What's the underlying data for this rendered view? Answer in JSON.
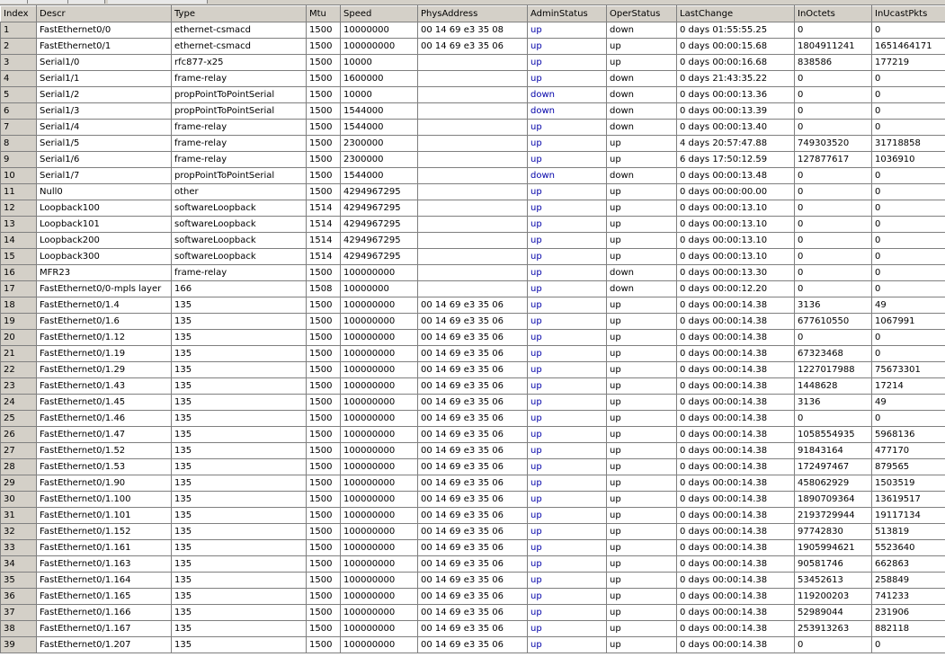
{
  "table": {
    "columns": [
      "Index",
      "Descr",
      "Type",
      "Mtu",
      "Speed",
      "PhysAddress",
      "AdminStatus",
      "OperStatus",
      "LastChange",
      "InOctets",
      "InUcastPkts"
    ],
    "rows": [
      [
        "1",
        "FastEthernet0/0",
        "ethernet-csmacd",
        "1500",
        "10000000",
        "00 14 69 e3 35 08",
        "up",
        "down",
        "0 days 01:55:55.25",
        "0",
        "0"
      ],
      [
        "2",
        "FastEthernet0/1",
        "ethernet-csmacd",
        "1500",
        "100000000",
        "00 14 69 e3 35 06",
        "up",
        "up",
        "0 days 00:00:15.68",
        "1804911241",
        "1651464171"
      ],
      [
        "3",
        "Serial1/0",
        "rfc877-x25",
        "1500",
        "10000",
        "",
        "up",
        "up",
        "0 days 00:00:16.68",
        "838586",
        "177219"
      ],
      [
        "4",
        "Serial1/1",
        "frame-relay",
        "1500",
        "1600000",
        "",
        "up",
        "down",
        "0 days 21:43:35.22",
        "0",
        "0"
      ],
      [
        "5",
        "Serial1/2",
        "propPointToPointSerial",
        "1500",
        "10000",
        "",
        "down",
        "down",
        "0 days 00:00:13.36",
        "0",
        "0"
      ],
      [
        "6",
        "Serial1/3",
        "propPointToPointSerial",
        "1500",
        "1544000",
        "",
        "down",
        "down",
        "0 days 00:00:13.39",
        "0",
        "0"
      ],
      [
        "7",
        "Serial1/4",
        "frame-relay",
        "1500",
        "1544000",
        "",
        "up",
        "down",
        "0 days 00:00:13.40",
        "0",
        "0"
      ],
      [
        "8",
        "Serial1/5",
        "frame-relay",
        "1500",
        "2300000",
        "",
        "up",
        "up",
        "4 days 20:57:47.88",
        "749303520",
        "31718858"
      ],
      [
        "9",
        "Serial1/6",
        "frame-relay",
        "1500",
        "2300000",
        "",
        "up",
        "up",
        "6 days 17:50:12.59",
        "127877617",
        "1036910"
      ],
      [
        "10",
        "Serial1/7",
        "propPointToPointSerial",
        "1500",
        "1544000",
        "",
        "down",
        "down",
        "0 days 00:00:13.48",
        "0",
        "0"
      ],
      [
        "11",
        "Null0",
        "other",
        "1500",
        "4294967295",
        "",
        "up",
        "up",
        "0 days 00:00:00.00",
        "0",
        "0"
      ],
      [
        "12",
        "Loopback100",
        "softwareLoopback",
        "1514",
        "4294967295",
        "",
        "up",
        "up",
        "0 days 00:00:13.10",
        "0",
        "0"
      ],
      [
        "13",
        "Loopback101",
        "softwareLoopback",
        "1514",
        "4294967295",
        "",
        "up",
        "up",
        "0 days 00:00:13.10",
        "0",
        "0"
      ],
      [
        "14",
        "Loopback200",
        "softwareLoopback",
        "1514",
        "4294967295",
        "",
        "up",
        "up",
        "0 days 00:00:13.10",
        "0",
        "0"
      ],
      [
        "15",
        "Loopback300",
        "softwareLoopback",
        "1514",
        "4294967295",
        "",
        "up",
        "up",
        "0 days 00:00:13.10",
        "0",
        "0"
      ],
      [
        "16",
        "MFR23",
        "frame-relay",
        "1500",
        "100000000",
        "",
        "up",
        "down",
        "0 days 00:00:13.30",
        "0",
        "0"
      ],
      [
        "17",
        "FastEthernet0/0-mpls layer",
        "166",
        "1508",
        "10000000",
        "",
        "up",
        "down",
        "0 days 00:00:12.20",
        "0",
        "0"
      ],
      [
        "18",
        "FastEthernet0/1.4",
        "135",
        "1500",
        "100000000",
        "00 14 69 e3 35 06",
        "up",
        "up",
        "0 days 00:00:14.38",
        "3136",
        "49"
      ],
      [
        "19",
        "FastEthernet0/1.6",
        "135",
        "1500",
        "100000000",
        "00 14 69 e3 35 06",
        "up",
        "up",
        "0 days 00:00:14.38",
        "677610550",
        "1067991"
      ],
      [
        "20",
        "FastEthernet0/1.12",
        "135",
        "1500",
        "100000000",
        "00 14 69 e3 35 06",
        "up",
        "up",
        "0 days 00:00:14.38",
        "0",
        "0"
      ],
      [
        "21",
        "FastEthernet0/1.19",
        "135",
        "1500",
        "100000000",
        "00 14 69 e3 35 06",
        "up",
        "up",
        "0 days 00:00:14.38",
        "67323468",
        "0"
      ],
      [
        "22",
        "FastEthernet0/1.29",
        "135",
        "1500",
        "100000000",
        "00 14 69 e3 35 06",
        "up",
        "up",
        "0 days 00:00:14.38",
        "1227017988",
        "75673301"
      ],
      [
        "23",
        "FastEthernet0/1.43",
        "135",
        "1500",
        "100000000",
        "00 14 69 e3 35 06",
        "up",
        "up",
        "0 days 00:00:14.38",
        "1448628",
        "17214"
      ],
      [
        "24",
        "FastEthernet0/1.45",
        "135",
        "1500",
        "100000000",
        "00 14 69 e3 35 06",
        "up",
        "up",
        "0 days 00:00:14.38",
        "3136",
        "49"
      ],
      [
        "25",
        "FastEthernet0/1.46",
        "135",
        "1500",
        "100000000",
        "00 14 69 e3 35 06",
        "up",
        "up",
        "0 days 00:00:14.38",
        "0",
        "0"
      ],
      [
        "26",
        "FastEthernet0/1.47",
        "135",
        "1500",
        "100000000",
        "00 14 69 e3 35 06",
        "up",
        "up",
        "0 days 00:00:14.38",
        "1058554935",
        "5968136"
      ],
      [
        "27",
        "FastEthernet0/1.52",
        "135",
        "1500",
        "100000000",
        "00 14 69 e3 35 06",
        "up",
        "up",
        "0 days 00:00:14.38",
        "91843164",
        "477170"
      ],
      [
        "28",
        "FastEthernet0/1.53",
        "135",
        "1500",
        "100000000",
        "00 14 69 e3 35 06",
        "up",
        "up",
        "0 days 00:00:14.38",
        "172497467",
        "879565"
      ],
      [
        "29",
        "FastEthernet0/1.90",
        "135",
        "1500",
        "100000000",
        "00 14 69 e3 35 06",
        "up",
        "up",
        "0 days 00:00:14.38",
        "458062929",
        "1503519"
      ],
      [
        "30",
        "FastEthernet0/1.100",
        "135",
        "1500",
        "100000000",
        "00 14 69 e3 35 06",
        "up",
        "up",
        "0 days 00:00:14.38",
        "1890709364",
        "13619517"
      ],
      [
        "31",
        "FastEthernet0/1.101",
        "135",
        "1500",
        "100000000",
        "00 14 69 e3 35 06",
        "up",
        "up",
        "0 days 00:00:14.38",
        "2193729944",
        "19117134"
      ],
      [
        "32",
        "FastEthernet0/1.152",
        "135",
        "1500",
        "100000000",
        "00 14 69 e3 35 06",
        "up",
        "up",
        "0 days 00:00:14.38",
        "97742830",
        "513819"
      ],
      [
        "33",
        "FastEthernet0/1.161",
        "135",
        "1500",
        "100000000",
        "00 14 69 e3 35 06",
        "up",
        "up",
        "0 days 00:00:14.38",
        "1905994621",
        "5523640"
      ],
      [
        "34",
        "FastEthernet0/1.163",
        "135",
        "1500",
        "100000000",
        "00 14 69 e3 35 06",
        "up",
        "up",
        "0 days 00:00:14.38",
        "90581746",
        "662863"
      ],
      [
        "35",
        "FastEthernet0/1.164",
        "135",
        "1500",
        "100000000",
        "00 14 69 e3 35 06",
        "up",
        "up",
        "0 days 00:00:14.38",
        "53452613",
        "258849"
      ],
      [
        "36",
        "FastEthernet0/1.165",
        "135",
        "1500",
        "100000000",
        "00 14 69 e3 35 06",
        "up",
        "up",
        "0 days 00:00:14.38",
        "119200203",
        "741233"
      ],
      [
        "37",
        "FastEthernet0/1.166",
        "135",
        "1500",
        "100000000",
        "00 14 69 e3 35 06",
        "up",
        "up",
        "0 days 00:00:14.38",
        "52989044",
        "231906"
      ],
      [
        "38",
        "FastEthernet0/1.167",
        "135",
        "1500",
        "100000000",
        "00 14 69 e3 35 06",
        "up",
        "up",
        "0 days 00:00:14.38",
        "253913263",
        "882118"
      ],
      [
        "39",
        "FastEthernet0/1.207",
        "135",
        "1500",
        "100000000",
        "00 14 69 e3 35 06",
        "up",
        "up",
        "0 days 00:00:14.38",
        "0",
        "0"
      ]
    ]
  },
  "colors": {
    "header_bg": "#d4d0c8",
    "status_text": "#0000a8",
    "grid_line": "#7f7f7f"
  }
}
